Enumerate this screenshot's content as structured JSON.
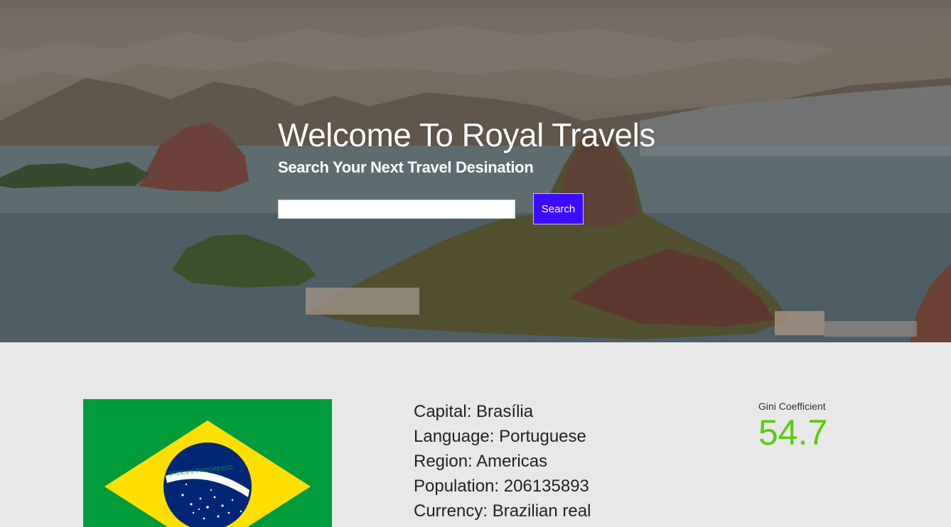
{
  "hero": {
    "title": "Welcome To Royal Travels",
    "subtitle": "Search Your Next Travel Desination",
    "search": {
      "value": "",
      "placeholder": "",
      "button_label": "Search"
    }
  },
  "country": {
    "flag_icon": "brazil-flag",
    "flag_motto": "ORDEM E PROGRESSO",
    "details": [
      {
        "label": "Capital:",
        "value": "Brasília"
      },
      {
        "label": "Language:",
        "value": "Portuguese"
      },
      {
        "label": "Region:",
        "value": "Americas"
      },
      {
        "label": "Population:",
        "value": "206135893"
      },
      {
        "label": "Currency:",
        "value": "Brazilian real"
      }
    ],
    "gini": {
      "label": "Gini Coefficient",
      "value": "54.7",
      "color": "#5ccc10"
    }
  },
  "colors": {
    "search_button": "#3d0bff",
    "flag_green": "#009b3a",
    "flag_yellow": "#fedf00",
    "flag_blue": "#002776"
  }
}
